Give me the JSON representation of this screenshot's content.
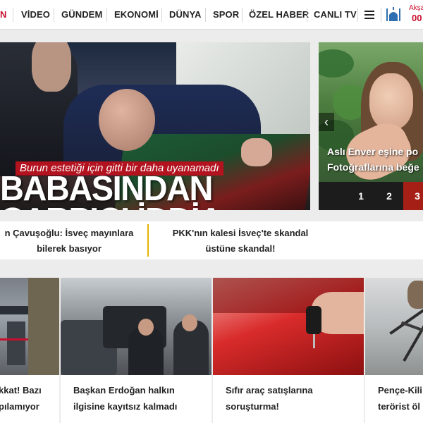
{
  "nav": {
    "first_partial": "N",
    "items": [
      "VİDEO",
      "GÜNDEM",
      "EKONOMİ",
      "DÜNYA",
      "SPOR",
      "ÖZEL HABER",
      "CANLI TV"
    ],
    "prayer_label": "Akşa",
    "prayer_time": "00"
  },
  "hero": {
    "caption": "Burun estetiği için gitti bir daha uyanamadı",
    "headline_line1": "BABASINDAN",
    "headline_line2": "ÇARPICI İDDİA"
  },
  "slider": {
    "title_line1": "Aslı Enver eşine po",
    "title_line2": "Fotoğraflarına beğe",
    "pages": [
      "1",
      "2",
      "3"
    ],
    "active_page": "3"
  },
  "ticker": {
    "items": [
      {
        "line1": "n Çavuşoğlu: İsveç mayınlara",
        "line2": "bilerek basıyor"
      },
      {
        "line1": "PKK'nın kalesi İsveç'te skandal",
        "line2": "üstüne skandal!"
      }
    ]
  },
  "cards": [
    {
      "line1": "kkat! Bazı",
      "line2": "pılamıyor"
    },
    {
      "line1": "Başkan Erdoğan halkın",
      "line2": "ilgisine kayıtsız kalmadı"
    },
    {
      "line1": "Sıfır araç satışlarına",
      "line2": "soruşturma!"
    },
    {
      "line1": "Pençe-Kili",
      "line2": "terörist öl"
    }
  ]
}
